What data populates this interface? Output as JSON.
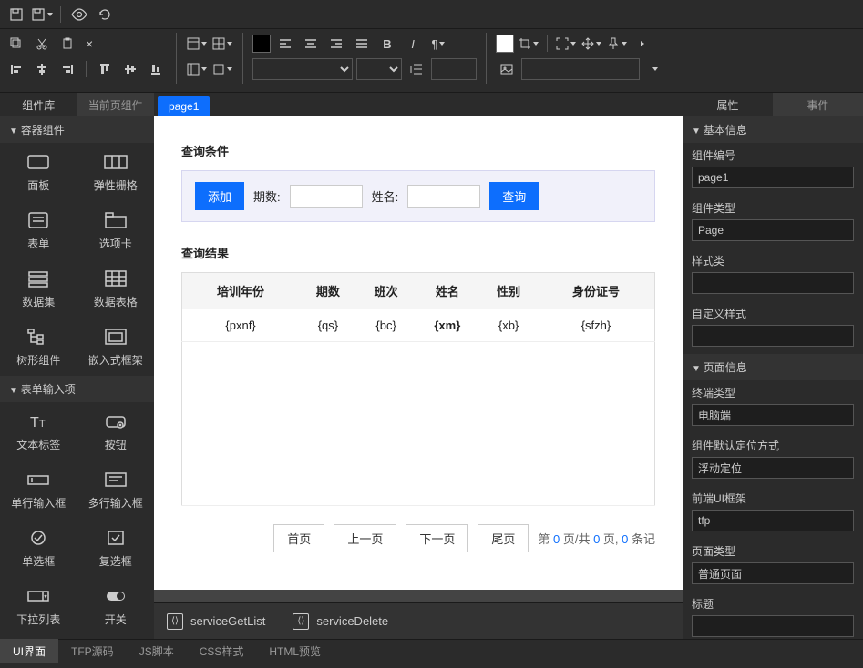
{
  "left_tabs": {
    "lib": "组件库",
    "current": "当前页组件"
  },
  "palette": {
    "containers": {
      "header": "容器组件",
      "items": [
        {
          "label": "面板",
          "icon": "rect"
        },
        {
          "label": "弹性栅格",
          "icon": "flexgrid"
        },
        {
          "label": "表单",
          "icon": "form"
        },
        {
          "label": "选项卡",
          "icon": "tabs"
        },
        {
          "label": "数据集",
          "icon": "dataset"
        },
        {
          "label": "数据表格",
          "icon": "grid"
        },
        {
          "label": "树形组件",
          "icon": "tree"
        },
        {
          "label": "嵌入式框架",
          "icon": "iframe"
        }
      ]
    },
    "inputs": {
      "header": "表单输入项",
      "items": [
        {
          "label": "文本标签",
          "icon": "tt"
        },
        {
          "label": "按钮",
          "icon": "button"
        },
        {
          "label": "单行输入框",
          "icon": "input"
        },
        {
          "label": "多行输入框",
          "icon": "textarea"
        },
        {
          "label": "单选框",
          "icon": "radio"
        },
        {
          "label": "复选框",
          "icon": "checkbox"
        },
        {
          "label": "下拉列表",
          "icon": "select"
        },
        {
          "label": "开关",
          "icon": "switch"
        }
      ]
    }
  },
  "page_tab": "page1",
  "canvas": {
    "query_title": "查询条件",
    "add_btn": "添加",
    "period_label": "期数:",
    "name_label": "姓名:",
    "search_btn": "查询",
    "result_title": "查询结果",
    "columns": [
      "培训年份",
      "期数",
      "班次",
      "姓名",
      "性别",
      "身份证号"
    ],
    "row": [
      "{pxnf}",
      "{qs}",
      "{bc}",
      "{xm}",
      "{xb}",
      "{sfzh}"
    ],
    "pager": {
      "first": "首页",
      "prev": "上一页",
      "next": "下一页",
      "last": "尾页",
      "text_prefix": "第 ",
      "text_mid": " 页/共 ",
      "text_mid2": " 页, ",
      "text_suffix": " 条记",
      "zero": "0"
    }
  },
  "services": {
    "get": "serviceGetList",
    "del": "serviceDelete"
  },
  "right_tabs": {
    "props": "属性",
    "events": "事件"
  },
  "props": {
    "basic": {
      "header": "基本信息",
      "fields": [
        {
          "label": "组件编号",
          "value": "page1"
        },
        {
          "label": "组件类型",
          "value": "Page"
        },
        {
          "label": "样式类",
          "value": ""
        },
        {
          "label": "自定义样式",
          "value": ""
        }
      ]
    },
    "page": {
      "header": "页面信息",
      "fields": [
        {
          "label": "终端类型",
          "value": "电脑端"
        },
        {
          "label": "组件默认定位方式",
          "value": "浮动定位"
        },
        {
          "label": "前端UI框架",
          "value": "tfp"
        },
        {
          "label": "页面类型",
          "value": "普通页面"
        },
        {
          "label": "标题",
          "value": ""
        }
      ]
    }
  },
  "footer_tabs": [
    "UI界面",
    "TFP源码",
    "JS脚本",
    "CSS样式",
    "HTML预览"
  ]
}
